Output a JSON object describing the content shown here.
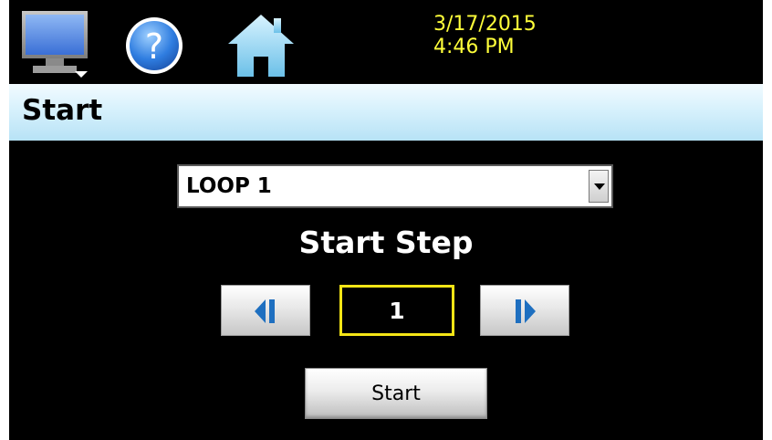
{
  "topbar": {
    "date": "3/17/2015",
    "time": "4:46 PM",
    "icons": [
      "monitor-icon",
      "help-icon",
      "home-icon"
    ],
    "datetime_color": "#ffff3a"
  },
  "page": {
    "title": "Start"
  },
  "loop_select": {
    "selected": "LOOP 1"
  },
  "start_step": {
    "label": "Start Step",
    "value": "1"
  },
  "actions": {
    "start_label": "Start"
  },
  "colors": {
    "background": "#000000",
    "title_bar": "#c6e9f9",
    "step_box_border": "#f4e516",
    "nav_arrow": "#1e6fc0"
  }
}
